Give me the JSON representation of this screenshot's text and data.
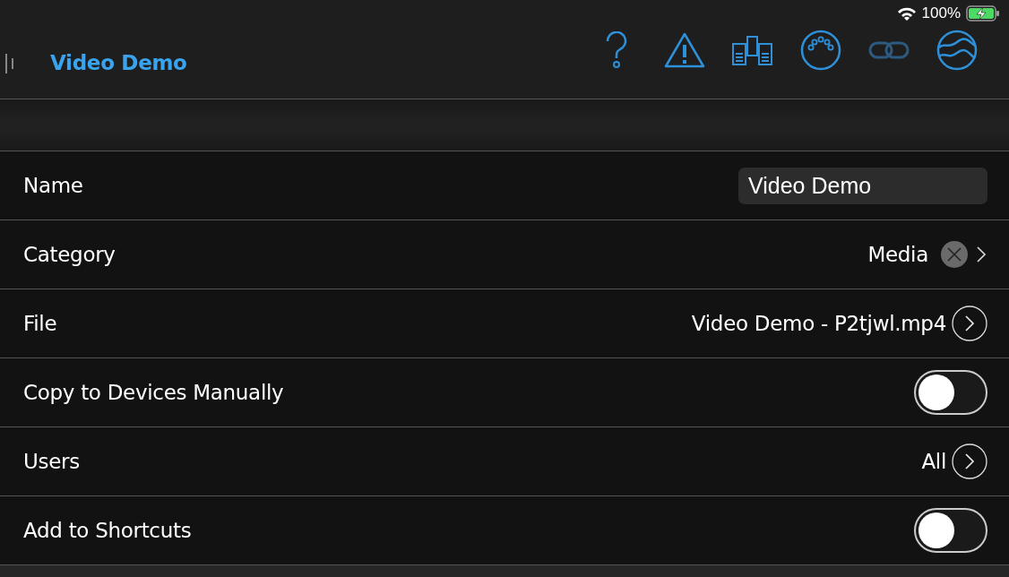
{
  "status_bar": {
    "battery_percent": "100%"
  },
  "nav_bar": {
    "title": "Video Demo",
    "toolbar": [
      {
        "kind": "help",
        "disabled": false
      },
      {
        "kind": "warning",
        "disabled": false
      },
      {
        "kind": "panels",
        "disabled": false
      },
      {
        "kind": "connector",
        "disabled": false
      },
      {
        "kind": "link",
        "disabled": true
      },
      {
        "kind": "wave",
        "disabled": false
      }
    ]
  },
  "rows": [
    {
      "kind": "field",
      "label": "Name",
      "value": "Video Demo"
    },
    {
      "kind": "clearable",
      "label": "Category",
      "value": "Media"
    },
    {
      "kind": "disclosure",
      "label": "File",
      "value": "Video Demo - P2tjwl.mp4"
    },
    {
      "kind": "toggle",
      "label": "Copy to Devices Manually",
      "on": false
    },
    {
      "kind": "disclosure",
      "label": "Users",
      "value": "All"
    },
    {
      "kind": "toggle",
      "label": "Add to Shortcuts",
      "on": false
    }
  ]
}
